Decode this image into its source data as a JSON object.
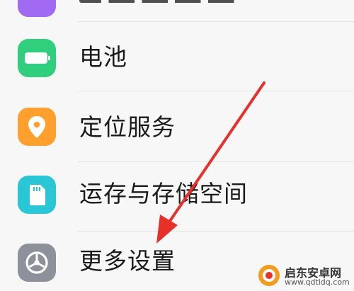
{
  "items": [
    {
      "label": "",
      "icon": "purple-app-icon",
      "color": "#9b5cf6"
    },
    {
      "label": "电池",
      "icon": "battery-icon",
      "color": "#2fcf7e"
    },
    {
      "label": "定位服务",
      "icon": "location-pin-icon",
      "color": "#ff9f2e"
    },
    {
      "label": "运存与存储空间",
      "icon": "sd-card-icon",
      "color": "#29c6d6"
    },
    {
      "label": "更多设置",
      "icon": "gear-icon",
      "color": "#8d929a"
    }
  ],
  "watermark": {
    "title": "启东安卓网",
    "url": "www.qdtldq.com"
  },
  "arrow_color": "#e8302a"
}
